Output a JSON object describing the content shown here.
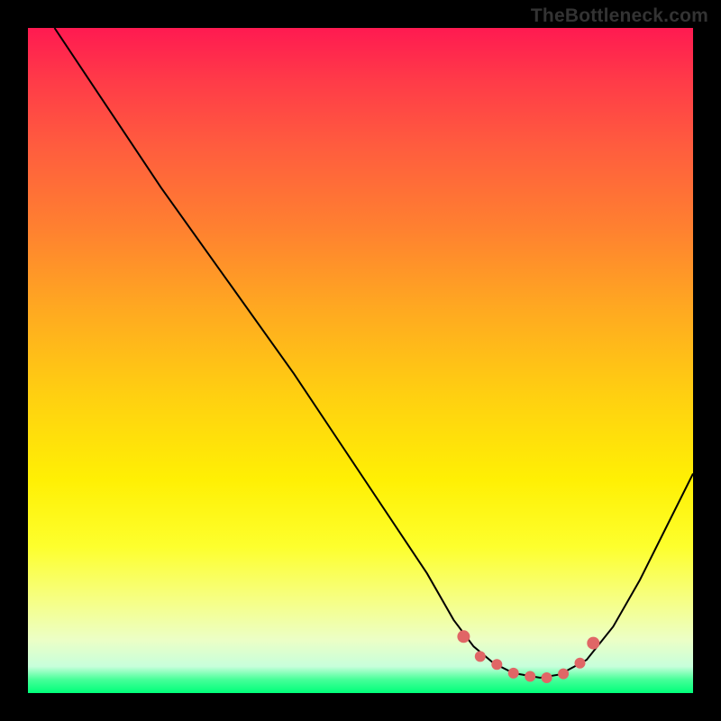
{
  "watermark": "TheBottleneck.com",
  "chart_data": {
    "type": "line",
    "title": "",
    "xlabel": "",
    "ylabel": "",
    "xlim": [
      0,
      100
    ],
    "ylim": [
      0,
      100
    ],
    "series": [
      {
        "name": "bottleneck-curve",
        "x": [
          4,
          10,
          20,
          30,
          40,
          50,
          60,
          64,
          67,
          70,
          73,
          77,
          80,
          84,
          88,
          92,
          96,
          100
        ],
        "values": [
          100,
          91,
          76,
          62,
          48,
          33,
          18,
          11,
          7,
          4.5,
          3,
          2.3,
          2.8,
          5,
          10,
          17,
          25,
          33
        ]
      }
    ],
    "markers": {
      "name": "minimum-dots",
      "x": [
        65.5,
        68,
        70.5,
        73,
        75.5,
        78,
        80.5,
        83,
        85
      ],
      "values": [
        8.5,
        5.5,
        4.3,
        3.0,
        2.5,
        2.3,
        2.9,
        4.5,
        7.5
      ],
      "color": "#e06666"
    },
    "gradient_stops": [
      {
        "pos": 0,
        "color": "#ff1a51"
      },
      {
        "pos": 50,
        "color": "#ffcf11"
      },
      {
        "pos": 80,
        "color": "#fdff2d"
      },
      {
        "pos": 100,
        "color": "#00ff7a"
      }
    ]
  }
}
